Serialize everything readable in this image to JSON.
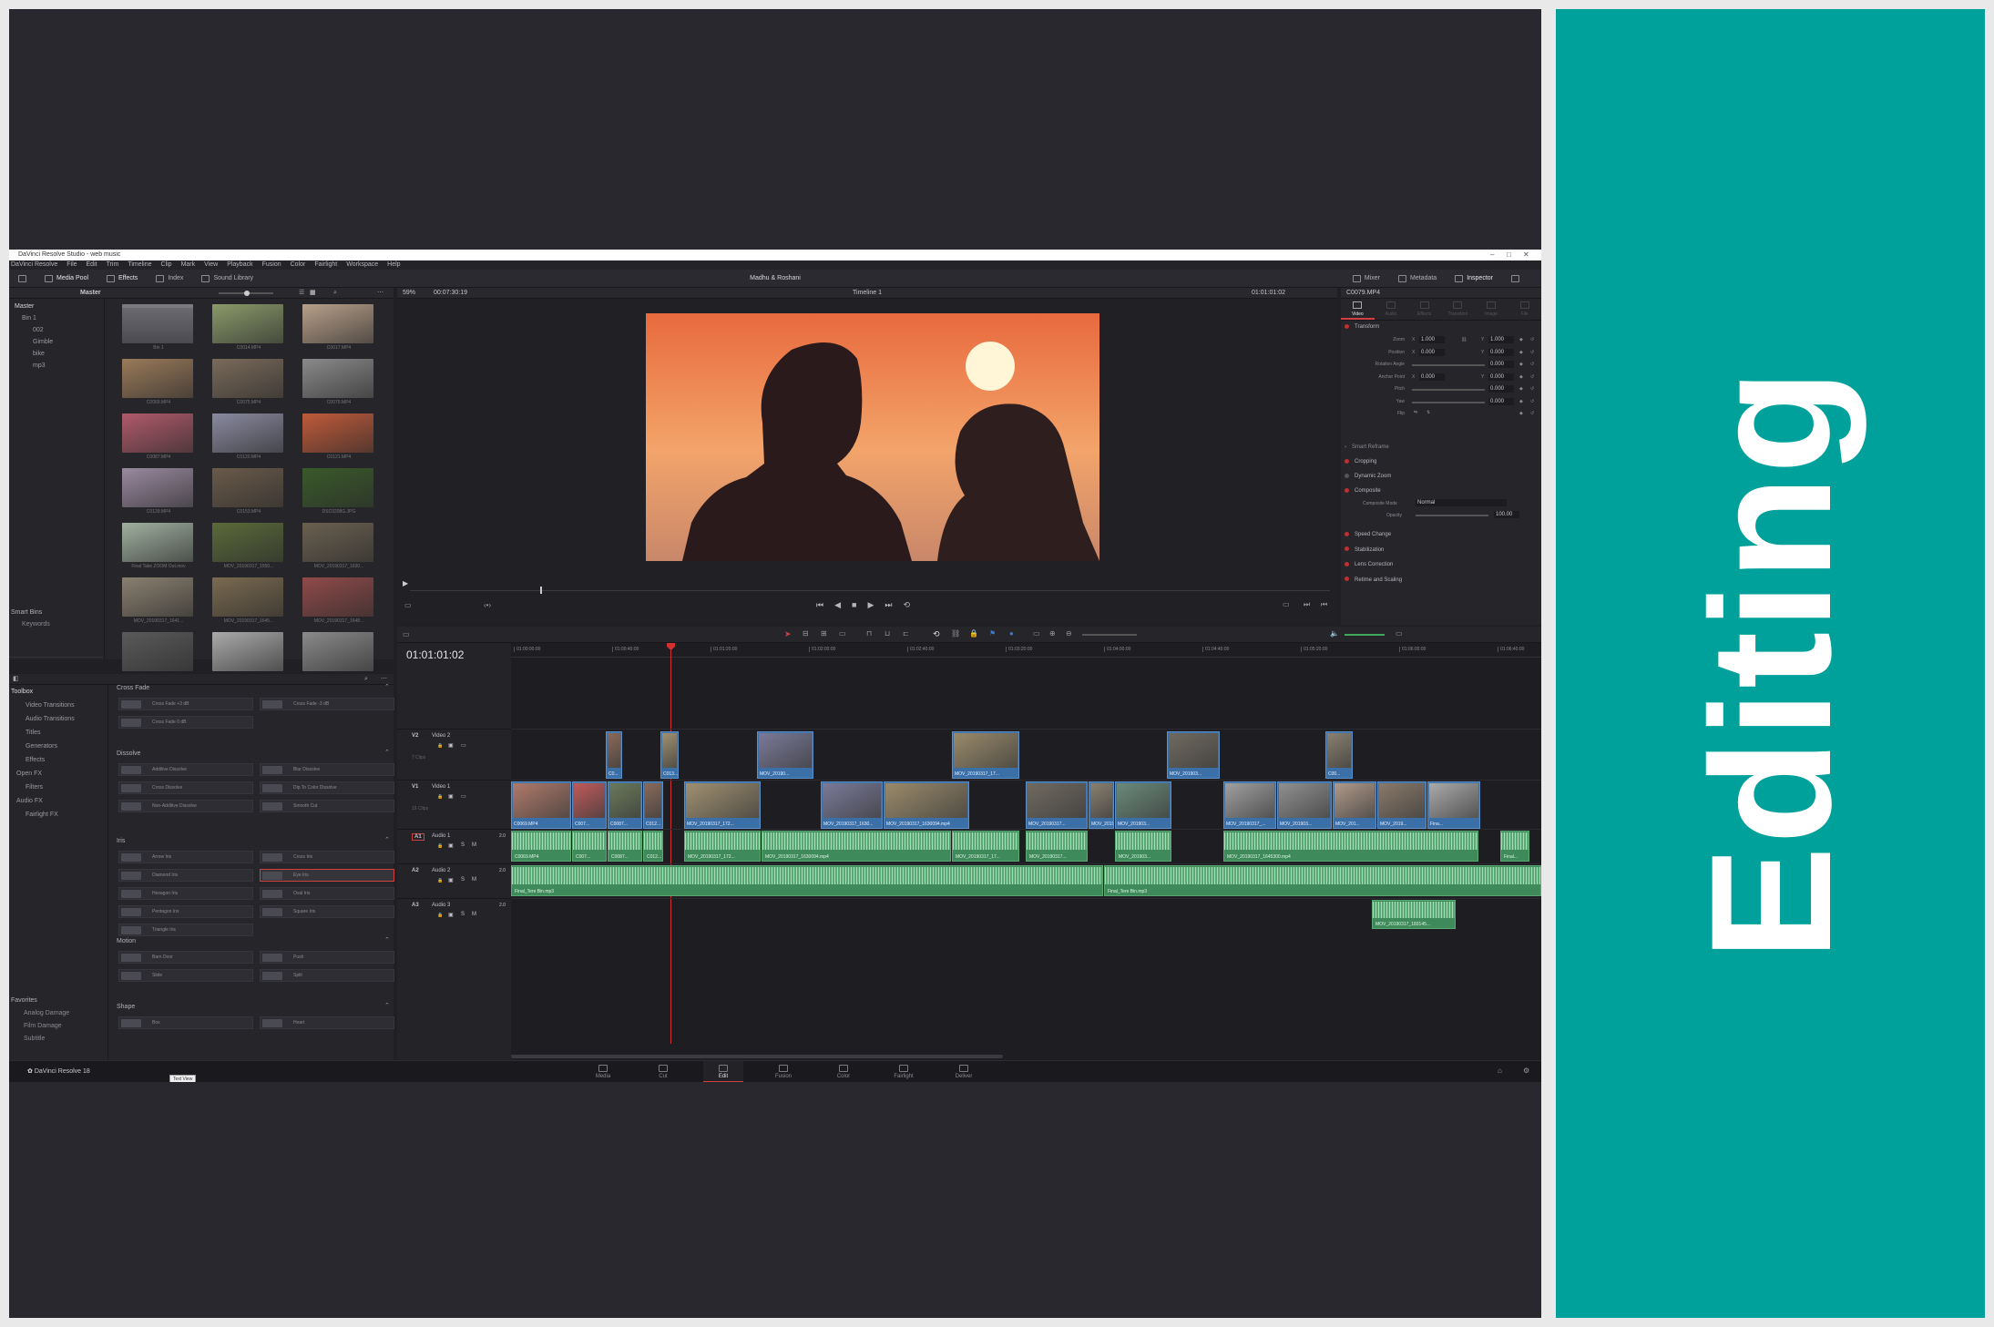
{
  "banner": {
    "text": "Editing"
  },
  "window": {
    "title": "DaVinci Resolve Studio - web music"
  },
  "menu": [
    "DaVinci Resolve",
    "File",
    "Edit",
    "Trim",
    "Timeline",
    "Clip",
    "Mark",
    "View",
    "Playback",
    "Fusion",
    "Color",
    "Fairlight",
    "Workspace",
    "Help"
  ],
  "toolbar": {
    "media_pool": "Media Pool",
    "effects": "Effects",
    "index": "Index",
    "sound_library": "Sound Library",
    "project_title": "Madhu & Roshani",
    "mixer": "Mixer",
    "metadata": "Metadata",
    "inspector": "Inspector"
  },
  "media_pool": {
    "bin_title": "Master",
    "tree": [
      "Master",
      "Bin 1",
      "002",
      "Gimble",
      "bike",
      "mp3"
    ],
    "smart_bins": "Smart Bins",
    "keywords": "Keywords",
    "clips": [
      {
        "name": "Bin 1",
        "kind": "folder"
      },
      {
        "name": "C0014.MP4",
        "color": "#8a9a6a"
      },
      {
        "name": "C0017.MP4",
        "color": "#b8a08a"
      },
      {
        "name": "C0069.MP4",
        "color": "#9a7a5a"
      },
      {
        "name": "C0075.MP4",
        "color": "#7a6a5a"
      },
      {
        "name": "C0079.MP4",
        "color": "#8a8a8a"
      },
      {
        "name": "C0087.MP4",
        "color": "#b05a6a"
      },
      {
        "name": "C0120.MP4",
        "color": "#8a8aa0"
      },
      {
        "name": "C0121.MP4",
        "color": "#c05a3a"
      },
      {
        "name": "C0129.MP4",
        "color": "#9a8aa0"
      },
      {
        "name": "C0153.MP4",
        "color": "#6a5a4a"
      },
      {
        "name": "DSC0208G.JPG",
        "color": "#3a5a2a"
      },
      {
        "name": "Final Take ZOOM Out.mov",
        "color": "#a0b0a0"
      },
      {
        "name": "MOV_20190317_1550...",
        "color": "#5a6a3a"
      },
      {
        "name": "MOV_20190317_1630...",
        "color": "#6a6050"
      },
      {
        "name": "MOV_20190317_1641...",
        "color": "#8a8070"
      },
      {
        "name": "MOV_20190317_1645...",
        "color": "#7a6a50"
      },
      {
        "name": "MOV_20190317_1648...",
        "color": "#904a4a"
      },
      {
        "name": "",
        "color": "#5a5a5a"
      },
      {
        "name": "",
        "color": "#aaaaaa"
      },
      {
        "name": "",
        "color": "#8a8a8a"
      }
    ]
  },
  "effects": {
    "toolbox": "Toolbox",
    "tree": [
      "Toolbox",
      "Video Transitions",
      "Audio Transitions",
      "Titles",
      "Generators",
      "Effects",
      "Open FX",
      "Filters",
      "Audio FX",
      "Fairlight FX"
    ],
    "favorites": "Favorites",
    "fav_items": [
      "Analog Damage",
      "Film Damage",
      "Subtitle"
    ],
    "groups": [
      {
        "title": "Cross Fade",
        "items": [
          "Cross Fade +3 dB",
          "Cross Fade -3 dB",
          "Cross Fade 0 dB"
        ]
      },
      {
        "title": "Dissolve",
        "items": [
          "Additive Dissolve",
          "Blur Dissolve",
          "Cross Dissolve",
          "Dip To Color Dissolve",
          "Non-Additive Dissolve",
          "Smooth Cut"
        ]
      },
      {
        "title": "Iris",
        "items": [
          "Arrow Iris",
          "Cross Iris",
          "Diamond Iris",
          "Eye Iris",
          "Hexagon Iris",
          "Oval Iris",
          "Pentagon Iris",
          "Square Iris",
          "Triangle Iris"
        ]
      },
      {
        "title": "Motion",
        "items": [
          "Barn Door",
          "Push",
          "Slide",
          "Split"
        ]
      },
      {
        "title": "Shape",
        "items": [
          "Box",
          "Heart"
        ]
      }
    ]
  },
  "viewer": {
    "zoom": "59%",
    "duration": "00:07:30:19",
    "timeline_name": "Timeline 1",
    "timecode": "01:01:01:02"
  },
  "inspector": {
    "clip": "C0079.MP4",
    "tabs": [
      "Video",
      "Audio",
      "Effects",
      "Transition",
      "Image",
      "File"
    ],
    "transform": "Transform",
    "rows": [
      {
        "label": "Zoom",
        "x": "1.000",
        "y": "1.000"
      },
      {
        "label": "Position",
        "x": "0.000",
        "y": "0.000"
      },
      {
        "label": "Rotation Angle",
        "v": "0.000"
      },
      {
        "label": "Anchor Point",
        "x": "0.000",
        "y": "0.000"
      },
      {
        "label": "Pitch",
        "v": "0.000"
      },
      {
        "label": "Yaw",
        "v": "0.000"
      },
      {
        "label": "Flip"
      }
    ],
    "smart_reframe": "Smart Reframe",
    "cropping": "Cropping",
    "dynamic_zoom": "Dynamic Zoom",
    "composite": "Composite",
    "composite_mode_label": "Composite Mode",
    "composite_mode": "Normal",
    "opacity_label": "Opacity",
    "opacity": "100.00",
    "sections": [
      "Speed Change",
      "Stabilization",
      "Lens Correction",
      "Retime and Scaling"
    ]
  },
  "timeline": {
    "timecode": "01:01:01:02",
    "ruler": [
      "01:00:00:00",
      "01:00:40:00",
      "01:01:20:00",
      "01:02:00:00",
      "01:02:40:00",
      "01:03:20:00",
      "01:04:00:00",
      "01:04:40:00",
      "01:05:20:00",
      "01:06:00:00",
      "01:06:40:00"
    ],
    "tracks": [
      {
        "id": "V2",
        "name": "Video 2",
        "count": "7 Clips"
      },
      {
        "id": "V1",
        "name": "Video 1",
        "count": "19 Clips"
      },
      {
        "id": "A1",
        "name": "Audio 1",
        "level": "2.0"
      },
      {
        "id": "A2",
        "name": "Audio 2",
        "level": "2.0"
      },
      {
        "id": "A3",
        "name": "Audio 3",
        "level": "2.0"
      }
    ],
    "v2_clips": [
      "C0...",
      "C013...",
      "MOV_20190...",
      "MOV_20190317_17...",
      "MOV_201903...",
      "C00..."
    ],
    "v1_clips": [
      "C0069.MP4",
      "C007...",
      "C0087...",
      "C012...",
      "MOV_20190317_172...",
      "MOV_20190317_1630...",
      "MOV_20190317_1630094.mp4",
      "MOV_20190317...",
      "MOV_201903...",
      "MOV_201903...",
      "MOV_20190317_...",
      "MOV_201903...",
      "MOV_201...",
      "MOV_2019...",
      "Fina..."
    ],
    "a1_clips": [
      "C0069.MP4",
      "C007...",
      "C0087...",
      "C012...",
      "MOV_20190317_172...",
      "MOV_20190317_1630094.mp4",
      "MOV_20190317_17...",
      "MOV_20190317...",
      "MOV_201903...",
      "MOV_20190317_1645300.mp4",
      "Final..."
    ],
    "a2_clips": [
      "Final_Tere Bin.mp3",
      "Final_Tere Bin.mp3"
    ],
    "a3_clips": [
      "MOV_20190317_183145..."
    ]
  },
  "pages": [
    "Media",
    "Cut",
    "Edit",
    "Fusion",
    "Color",
    "Fairlight",
    "Deliver"
  ],
  "app_name": "DaVinci Resolve 18",
  "tooltip": "Text View"
}
